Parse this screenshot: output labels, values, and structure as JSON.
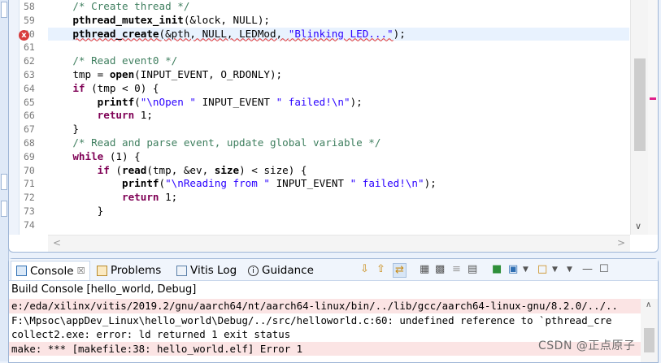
{
  "editor": {
    "lines": [
      {
        "num": "58",
        "segments": [
          {
            "t": "    ",
            "c": ""
          },
          {
            "t": "/* Create thread */",
            "c": "cm"
          }
        ]
      },
      {
        "num": "59",
        "segments": [
          {
            "t": "    ",
            "c": ""
          },
          {
            "t": "pthread_mutex_init",
            "c": "fn"
          },
          {
            "t": "(&lock, NULL);",
            "c": ""
          }
        ]
      },
      {
        "num": "60",
        "segments": [
          {
            "t": "    ",
            "c": ""
          },
          {
            "t": "pthread_create",
            "c": "fn sq"
          },
          {
            "t": "(&pth, NULL, LEDMod, ",
            "c": "sq"
          },
          {
            "t": "\"Blinking LED...\"",
            "c": "st sq"
          },
          {
            "t": ");",
            "c": ""
          }
        ],
        "error": true,
        "highlight": true
      },
      {
        "num": "61",
        "segments": [
          {
            "t": "",
            "c": ""
          }
        ]
      },
      {
        "num": "62",
        "segments": [
          {
            "t": "    ",
            "c": ""
          },
          {
            "t": "/* Read event0 */",
            "c": "cm"
          }
        ]
      },
      {
        "num": "63",
        "segments": [
          {
            "t": "    tmp = ",
            "c": ""
          },
          {
            "t": "open",
            "c": "fn"
          },
          {
            "t": "(INPUT_EVENT, O_RDONLY);",
            "c": ""
          }
        ]
      },
      {
        "num": "64",
        "segments": [
          {
            "t": "    ",
            "c": ""
          },
          {
            "t": "if",
            "c": "kw"
          },
          {
            "t": " (tmp < 0) {",
            "c": ""
          }
        ]
      },
      {
        "num": "65",
        "segments": [
          {
            "t": "        ",
            "c": ""
          },
          {
            "t": "printf",
            "c": "fn"
          },
          {
            "t": "(",
            "c": ""
          },
          {
            "t": "\"\\nOpen \"",
            "c": "st"
          },
          {
            "t": " INPUT_EVENT ",
            "c": ""
          },
          {
            "t": "\" failed!\\n\"",
            "c": "st"
          },
          {
            "t": ");",
            "c": ""
          }
        ]
      },
      {
        "num": "66",
        "segments": [
          {
            "t": "        ",
            "c": ""
          },
          {
            "t": "return",
            "c": "kw"
          },
          {
            "t": " 1;",
            "c": ""
          }
        ]
      },
      {
        "num": "67",
        "segments": [
          {
            "t": "    }",
            "c": ""
          }
        ]
      },
      {
        "num": "68",
        "segments": [
          {
            "t": "    ",
            "c": ""
          },
          {
            "t": "/* Read and parse event, update global variable */",
            "c": "cm"
          }
        ]
      },
      {
        "num": "69",
        "segments": [
          {
            "t": "    ",
            "c": ""
          },
          {
            "t": "while",
            "c": "kw"
          },
          {
            "t": " (1) {",
            "c": ""
          }
        ]
      },
      {
        "num": "70",
        "segments": [
          {
            "t": "        ",
            "c": ""
          },
          {
            "t": "if",
            "c": "kw"
          },
          {
            "t": " (",
            "c": ""
          },
          {
            "t": "read",
            "c": "fn"
          },
          {
            "t": "(tmp, &ev, ",
            "c": ""
          },
          {
            "t": "size",
            "c": "fn"
          },
          {
            "t": ") < size) {",
            "c": ""
          }
        ]
      },
      {
        "num": "71",
        "segments": [
          {
            "t": "            ",
            "c": ""
          },
          {
            "t": "printf",
            "c": "fn"
          },
          {
            "t": "(",
            "c": ""
          },
          {
            "t": "\"\\nReading from \"",
            "c": "st"
          },
          {
            "t": " INPUT_EVENT ",
            "c": ""
          },
          {
            "t": "\" failed!\\n\"",
            "c": "st"
          },
          {
            "t": ");",
            "c": ""
          }
        ]
      },
      {
        "num": "72",
        "segments": [
          {
            "t": "            ",
            "c": ""
          },
          {
            "t": "return",
            "c": "kw"
          },
          {
            "t": " 1;",
            "c": ""
          }
        ]
      },
      {
        "num": "73",
        "segments": [
          {
            "t": "        }",
            "c": ""
          }
        ]
      },
      {
        "num": "74",
        "segments": [
          {
            "t": "",
            "c": ""
          }
        ]
      }
    ]
  },
  "tabs": [
    {
      "id": "console",
      "label": "Console",
      "close": "☒",
      "active": true
    },
    {
      "id": "problems",
      "label": "Problems"
    },
    {
      "id": "vitis",
      "label": "Vitis Log"
    },
    {
      "id": "guidance",
      "label": "Guidance"
    }
  ],
  "console": {
    "title": "Build Console [hello_world, Debug]",
    "lines": [
      {
        "text": "e:/eda/xilinx/vitis/2019.2/gnu/aarch64/nt/aarch64-linux/bin/../lib/gcc/aarch64-linux-gnu/8.2.0/../..",
        "error": true
      },
      {
        "text": "F:\\Mpsoc\\appDev_Linux\\hello_world\\Debug/../src/helloworld.c:60: undefined reference to `pthread_cre",
        "error": false
      },
      {
        "text": "collect2.exe: error: ld returned 1 exit status",
        "error": false
      },
      {
        "text": "make: *** [makefile:38: hello_world.elf] Error 1",
        "error": true
      }
    ]
  },
  "watermark": "CSDN @正点原子"
}
